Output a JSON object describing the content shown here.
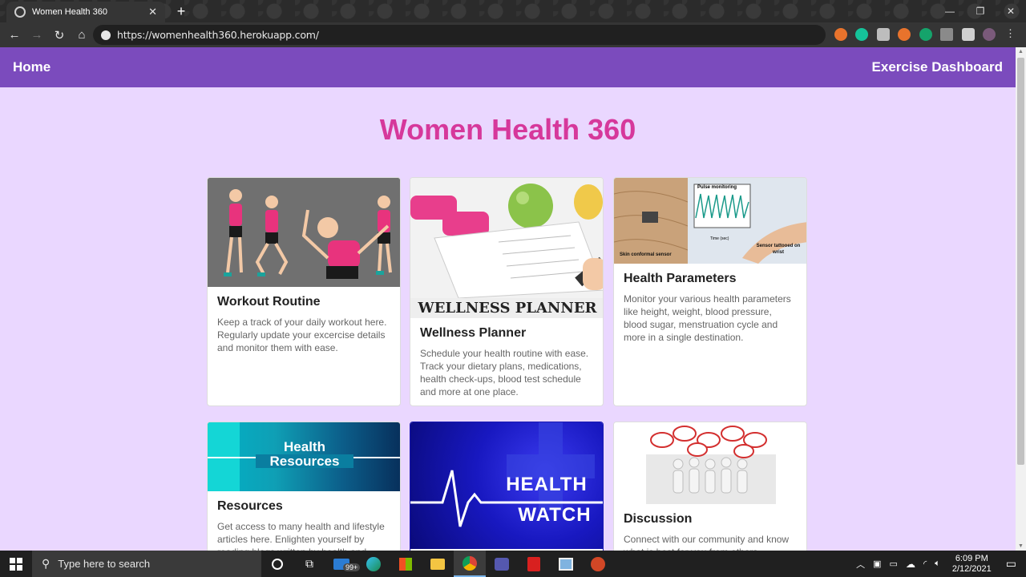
{
  "browser": {
    "tab_title": "Women Health 360",
    "url": "https://womenhealth360.herokuapp.com/"
  },
  "nav": {
    "home": "Home",
    "exercise_dashboard": "Exercise Dashboard"
  },
  "page_title": "Women Health 360",
  "cards": [
    {
      "title": "Workout Routine",
      "text": "Keep a track of your daily workout here. Regularly update your excercise details and monitor them with ease."
    },
    {
      "title": "Wellness Planner",
      "text": "Schedule your health routine with ease. Track your dietary plans, medications, health check-ups, blood test schedule and more at one place.",
      "image_caption": "WELLNESS PLANNER"
    },
    {
      "title": "Health Parameters",
      "text": "Monitor your various health parameters like height, weight, blood pressure, blood sugar, menstruation cycle and more in a single destination.",
      "image_caption": "Pulse monitoring",
      "image_label_left": "Skin conformal sensor",
      "image_label_right": "Sensor tattooed on wrist",
      "image_axis_label": "Time (sec)"
    },
    {
      "title": "Resources",
      "text": "Get access to many health and lifestyle articles here. Enlighten yourself by reading blogs written by health and wellness",
      "image_caption_1": "Health",
      "image_caption_2": "Resources"
    },
    {
      "title": "Health Watch",
      "image_caption_1": "HEALTH",
      "image_caption_2": "WATCH"
    },
    {
      "title": "Discussion",
      "text": "Connect with our community and know what is best for you from others, including"
    }
  ],
  "taskbar": {
    "search_placeholder": "Type here to search",
    "badge": "99+",
    "time": "6:09 PM",
    "date": "2/12/2021"
  },
  "colors": {
    "navbar": "#7b4bbd",
    "page_bg": "#ead7ff",
    "heading": "#d6389b"
  }
}
